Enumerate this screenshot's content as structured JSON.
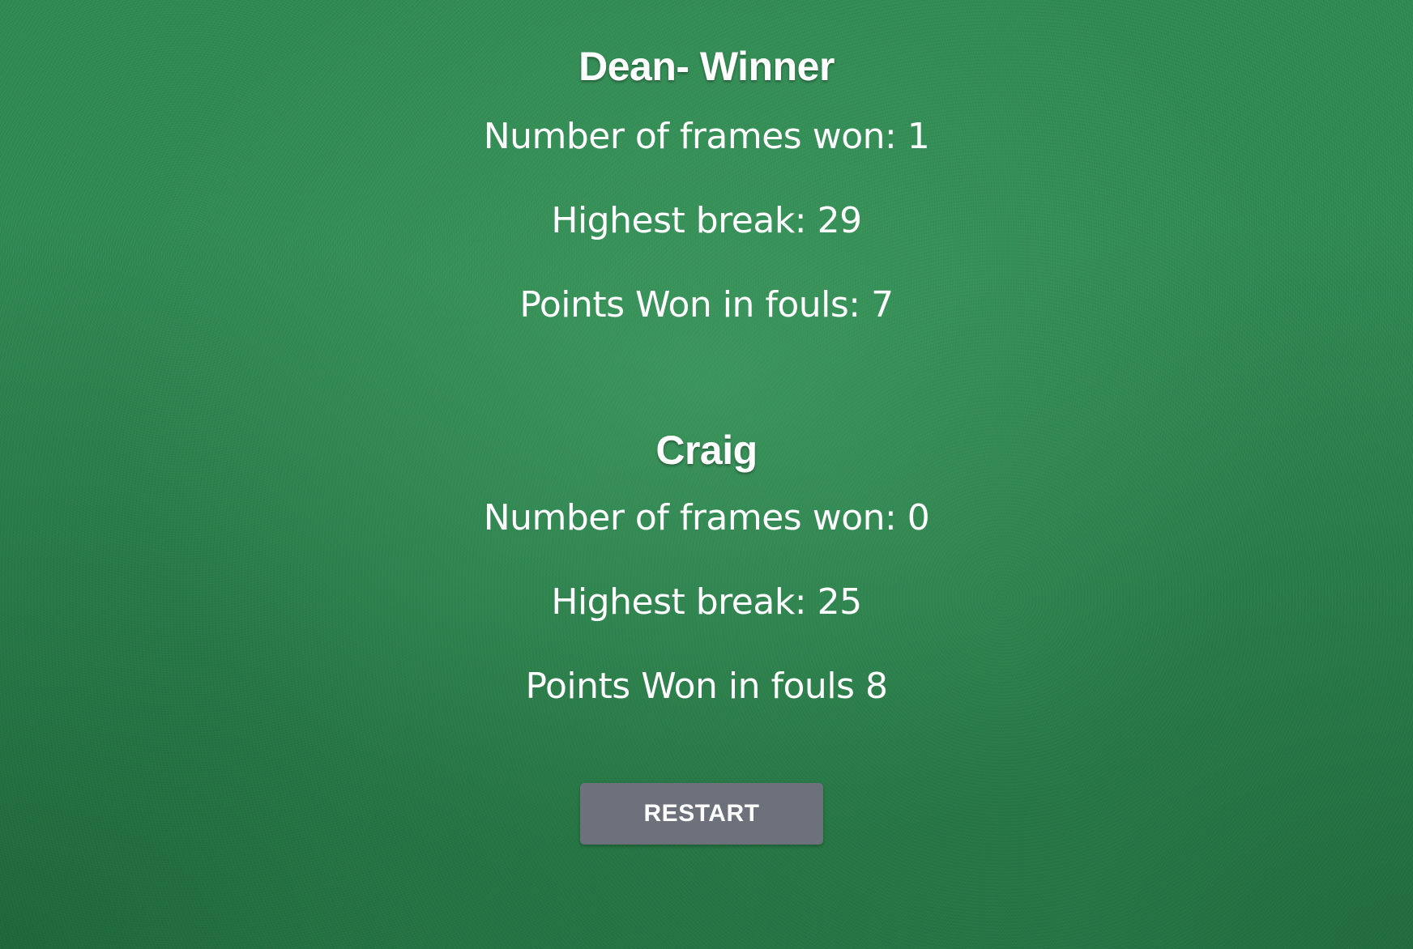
{
  "players": [
    {
      "heading": "Dean- Winner",
      "frames_won": "Number of frames won: 1",
      "highest_break": "Highest break: 29",
      "foul_points": "Points Won in fouls: 7"
    },
    {
      "heading": "Craig",
      "frames_won": "Number of frames won: 0",
      "highest_break": "Highest break: 25",
      "foul_points": "Points Won in fouls 8"
    }
  ],
  "restart_label": "RESTART",
  "colors": {
    "felt": "#2f8a52",
    "text": "#ffffff",
    "button": "#6d717c"
  }
}
